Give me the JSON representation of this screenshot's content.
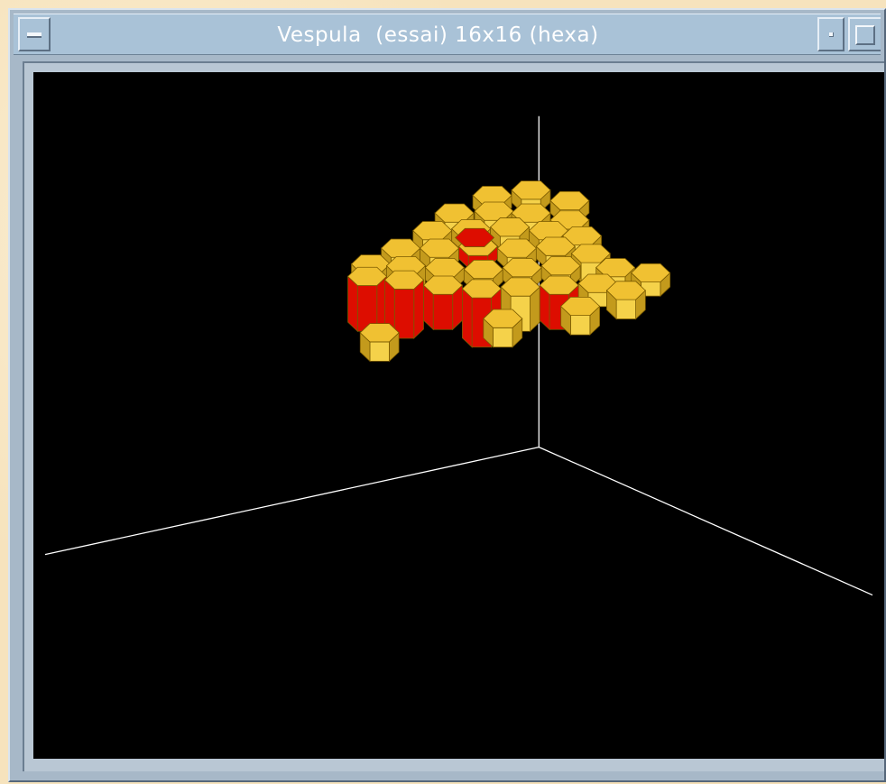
{
  "window": {
    "title": "Vespula  (essai) 16x16 (hexa)",
    "menu_icon": "window-menu-icon",
    "minimize_icon": "minimize-icon",
    "maximize_icon": "maximize-icon"
  },
  "scene": {
    "background": "#000000",
    "axis_color": "#ffffff",
    "cell_top_color": "#f0c132",
    "cell_side_light": "#f5d24a",
    "cell_side_dark": "#c39a1c",
    "open_cell_color": "#dd0d00",
    "shape": "hexagonal-cells"
  }
}
